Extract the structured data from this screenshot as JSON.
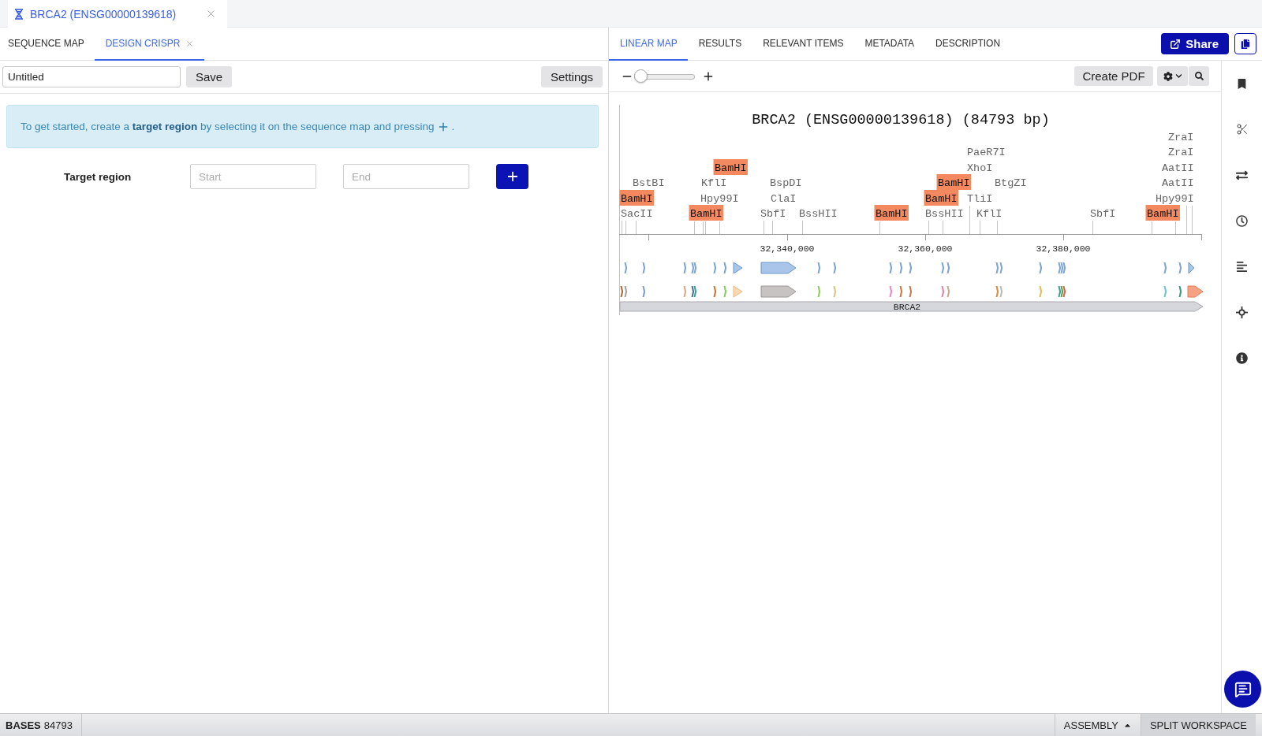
{
  "document_tab": {
    "title": "BRCA2 (ENSG00000139618)"
  },
  "left_panel": {
    "tabs": [
      {
        "label": "SEQUENCE MAP",
        "selected": false,
        "closable": false
      },
      {
        "label": "DESIGN CRISPR",
        "selected": true,
        "closable": true
      }
    ],
    "name_field": {
      "value": "Untitled"
    },
    "save_button": "Save",
    "settings_button": "Settings",
    "info_banner": {
      "text": "To get started, create a **target region** by selecting it on the sequence map and pressing",
      "end": "."
    },
    "target_region": {
      "label": "Target region",
      "start_field": {
        "placeholder": "Start"
      },
      "end_field": {
        "placeholder": "End"
      }
    }
  },
  "right_panel": {
    "tabs": [
      {
        "label": "LINEAR MAP",
        "selected": true
      },
      {
        "label": "RESULTS",
        "selected": false
      },
      {
        "label": "RELEVANT ITEMS",
        "selected": false
      },
      {
        "label": "METADATA",
        "selected": false
      },
      {
        "label": "DESCRIPTION",
        "selected": false
      }
    ],
    "share_button": "Share",
    "zoom": {
      "level": 0
    },
    "create_pdf_button": "Create PDF",
    "map": {
      "title": "BRCA2 (ENSG00000139618) (84793 bp)",
      "enzymes": [
        {
          "label": "ZraI",
          "highlighted": false
        },
        {
          "label": "PaeR7I",
          "highlighted": false
        },
        {
          "label": "ZraI",
          "highlighted": false
        },
        {
          "label": "BamHI",
          "highlighted": true
        },
        {
          "label": "XhoI",
          "highlighted": false
        },
        {
          "label": "AatII",
          "highlighted": false
        },
        {
          "label": "BstBI",
          "highlighted": false
        },
        {
          "label": "KflI",
          "highlighted": false
        },
        {
          "label": "BspDI",
          "highlighted": false
        },
        {
          "label": "BamHI",
          "highlighted": true
        },
        {
          "label": "BtgZI",
          "highlighted": false
        },
        {
          "label": "AatII",
          "highlighted": false
        },
        {
          "label": "BamHI",
          "highlighted": true
        },
        {
          "label": "Hpy99I",
          "highlighted": false
        },
        {
          "label": "ClaI",
          "highlighted": false
        },
        {
          "label": "BamHI",
          "highlighted": true
        },
        {
          "label": "TliI",
          "highlighted": false
        },
        {
          "label": "Hpy99I",
          "highlighted": false
        },
        {
          "label": "SacII",
          "highlighted": false
        },
        {
          "label": "BamHI",
          "highlighted": true
        },
        {
          "label": "SbfI",
          "highlighted": false
        },
        {
          "label": "BssHII",
          "highlighted": false
        },
        {
          "label": "BamHI",
          "highlighted": true
        },
        {
          "label": "BssHII",
          "highlighted": false
        },
        {
          "label": "KflI",
          "highlighted": false
        },
        {
          "label": "SbfI",
          "highlighted": false
        },
        {
          "label": "BamHI",
          "highlighted": true
        }
      ],
      "axis_labels": [
        "32,340,000",
        "32,360,000",
        "32,380,000"
      ],
      "gene": "BRCA2"
    }
  },
  "status_bar": {
    "bases": "**BASES** 84793",
    "assembly_button": "ASSEMBLY",
    "split_button": "SPLIT WORKSPACE"
  }
}
